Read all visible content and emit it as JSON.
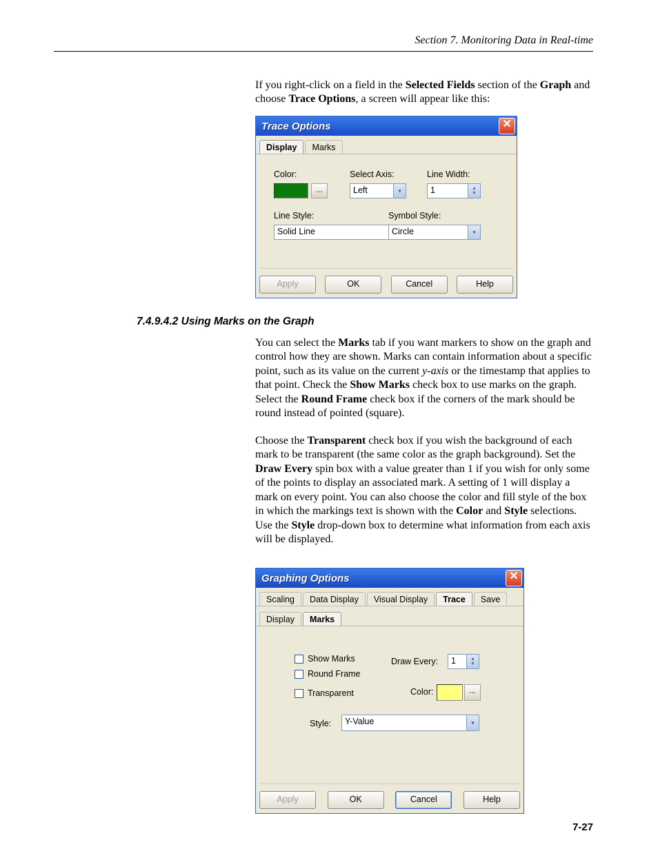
{
  "header": {
    "running_head": "Section 7.  Monitoring Data in Real-time"
  },
  "intro": {
    "prefix": "If you right-click on a field in the ",
    "b1": "Selected Fields",
    "mid1": " section of the ",
    "b2": "Graph",
    "mid2": " and choose ",
    "b3": "Trace Options",
    "suffix": ", a screen will appear like this:"
  },
  "dlg1": {
    "title": "Trace Options",
    "tabs": {
      "display": "Display",
      "marks": "Marks"
    },
    "labels": {
      "color": "Color:",
      "select_axis": "Select Axis:",
      "line_width": "Line Width:",
      "line_style": "Line Style:",
      "symbol_style": "Symbol Style:"
    },
    "values": {
      "select_axis": "Left",
      "line_width": "1",
      "line_style": "Solid Line",
      "symbol_style": "Circle"
    },
    "dot_label": "...",
    "buttons": {
      "apply": "Apply",
      "ok": "OK",
      "cancel": "Cancel",
      "help": "Help"
    }
  },
  "subhead": "7.4.9.4.2  Using Marks on the Graph",
  "p1": {
    "s0": "You can select the ",
    "b0": "Marks",
    "s1": " tab if you want markers to show on the graph and control how they are shown.  Marks can contain information about a specific point, such as its value on the current ",
    "i0": "y-axis",
    "s2": " or the timestamp that applies to that point.  Check the ",
    "b1": "Show Marks",
    "s3": " check box to use marks on the graph.  Select the ",
    "b2": "Round Frame",
    "s4": " check box if the corners of the mark should be round instead of pointed (square)."
  },
  "p2": {
    "s0": "Choose the ",
    "b0": "Transparent",
    "s1": " check box if you wish the background of each mark to be transparent (the same color as the graph background).  Set the ",
    "b1": "Draw Every",
    "s2": " spin box with a value greater than 1 if you wish for only some of the points to display an associated mark.  A setting of 1 will display a mark on every point.  You can also choose the color and fill style of the box in which the markings text is shown with the ",
    "b2": "Color",
    "s3": " and ",
    "b3": "Style",
    "s4": " selections.  Use the ",
    "b4": "Style",
    "s5": " drop-down box to determine what information from each axis will be displayed."
  },
  "dlg2": {
    "title": "Graphing Options",
    "tabs": {
      "scaling": "Scaling",
      "data_display": "Data Display",
      "visual_display": "Visual Display",
      "trace": "Trace",
      "save": "Save",
      "display": "Display",
      "marks": "Marks"
    },
    "labels": {
      "show_marks": "Show Marks",
      "round_frame": "Round Frame",
      "transparent": "Transparent",
      "draw_every": "Draw Every:",
      "color": "Color:",
      "style": "Style:"
    },
    "values": {
      "draw_every": "1",
      "style": "Y-Value"
    },
    "dot_label": "...",
    "buttons": {
      "apply": "Apply",
      "ok": "OK",
      "cancel": "Cancel",
      "help": "Help"
    }
  },
  "page_number": "7-27"
}
